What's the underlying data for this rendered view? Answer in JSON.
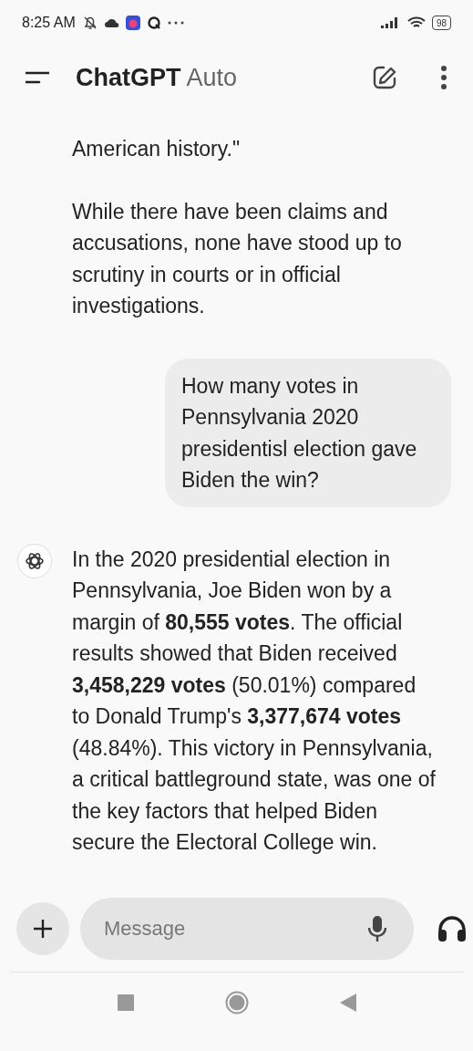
{
  "status_bar": {
    "time": "8:25 AM",
    "battery": "98"
  },
  "header": {
    "title": "ChatGPT",
    "model": "Auto"
  },
  "messages": [
    {
      "kind": "assistant",
      "avatar": false,
      "paragraphs": [
        "American history.\"",
        "While there have been claims and accusations, none have stood up to scrutiny in courts or in official investigations."
      ]
    },
    {
      "kind": "user",
      "paragraphs": [
        "How many votes in Pennsylvania 2020 presidentisl election gave Biden the win?"
      ]
    },
    {
      "kind": "assistant",
      "avatar": true,
      "paragraphs": [
        "In the 2020 presidential election in Pennsylvania, Joe Biden won by a margin of **80,555 votes**. The official results showed that Biden received **3,458,229 votes** (50.01%) compared to Donald Trump's **3,377,674 votes** (48.84%). This victory in Pennsylvania, a critical battleground state, was one of the key factors that helped Biden secure the Electoral College win."
      ]
    }
  ],
  "composer": {
    "placeholder": "Message"
  }
}
